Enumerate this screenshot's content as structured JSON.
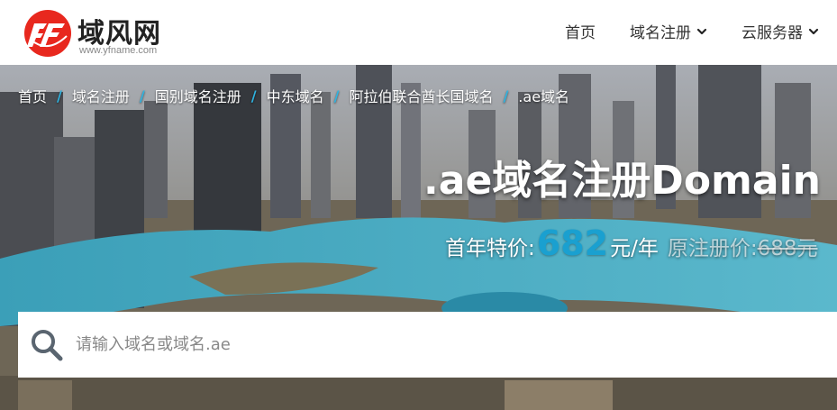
{
  "brand": {
    "name": "域风网",
    "url": "www.yfname.com",
    "accent": "#e8281e"
  },
  "nav": {
    "items": [
      {
        "label": "首页",
        "dropdown": false
      },
      {
        "label": "域名注册",
        "dropdown": true
      },
      {
        "label": "云服务器",
        "dropdown": true
      }
    ]
  },
  "breadcrumb": {
    "items": [
      "首页",
      "域名注册",
      "国别域名注册",
      "中东域名",
      "阿拉伯联合酋长国域名",
      ".ae域名"
    ],
    "separator": "/"
  },
  "hero": {
    "title": ".ae域名注册Domain",
    "price_label": "首年特价:",
    "price_value": "682",
    "price_unit": "元/年",
    "original_label": "原注册价:",
    "original_value": "688元"
  },
  "search": {
    "placeholder": "请输入域名或域名.ae",
    "value": ""
  },
  "colors": {
    "price": "#1aa0d0",
    "separator": "#2fb3e0"
  }
}
